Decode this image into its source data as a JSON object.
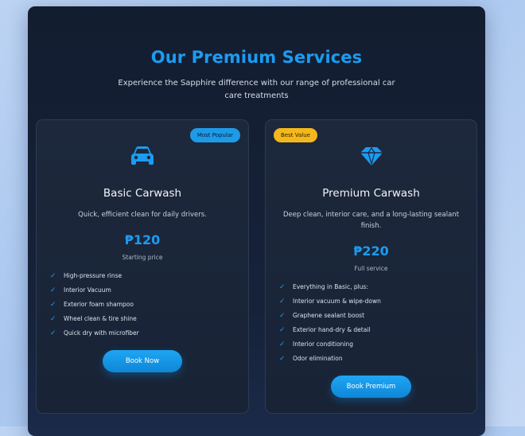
{
  "section": {
    "title": "Our Premium Services",
    "subtitle": "Experience the Sapphire difference with our range of professional car care treatments"
  },
  "colors": {
    "accent": "#1b9cf2",
    "badge_popular": "#1e9be8",
    "badge_value": "#f4b81c",
    "panel": "#131d30"
  },
  "cards": [
    {
      "badge": "Most Popular",
      "icon": "car-icon",
      "name": "Basic Carwash",
      "description": "Quick, efficient clean for daily drivers.",
      "price": "₱120",
      "price_note": "Starting price",
      "features": [
        "High-pressure rinse",
        "Interior Vacuum",
        "Exterior foam shampoo",
        "Wheel clean & tire shine",
        "Quick dry with microfiber"
      ],
      "button": "Book Now"
    },
    {
      "badge": "Best Value",
      "icon": "gem-icon",
      "name": "Premium Carwash",
      "description": "Deep clean, interior care, and a long-lasting sealant finish.",
      "price": "₱220",
      "price_note": "Full service",
      "features": [
        "Everything in Basic, plus:",
        "Interior vacuum & wipe-down",
        "Graphene sealant boost",
        "Exterior hand-dry & detail",
        "Interior conditioning",
        "Odor elimination"
      ],
      "button": "Book Premium"
    }
  ]
}
